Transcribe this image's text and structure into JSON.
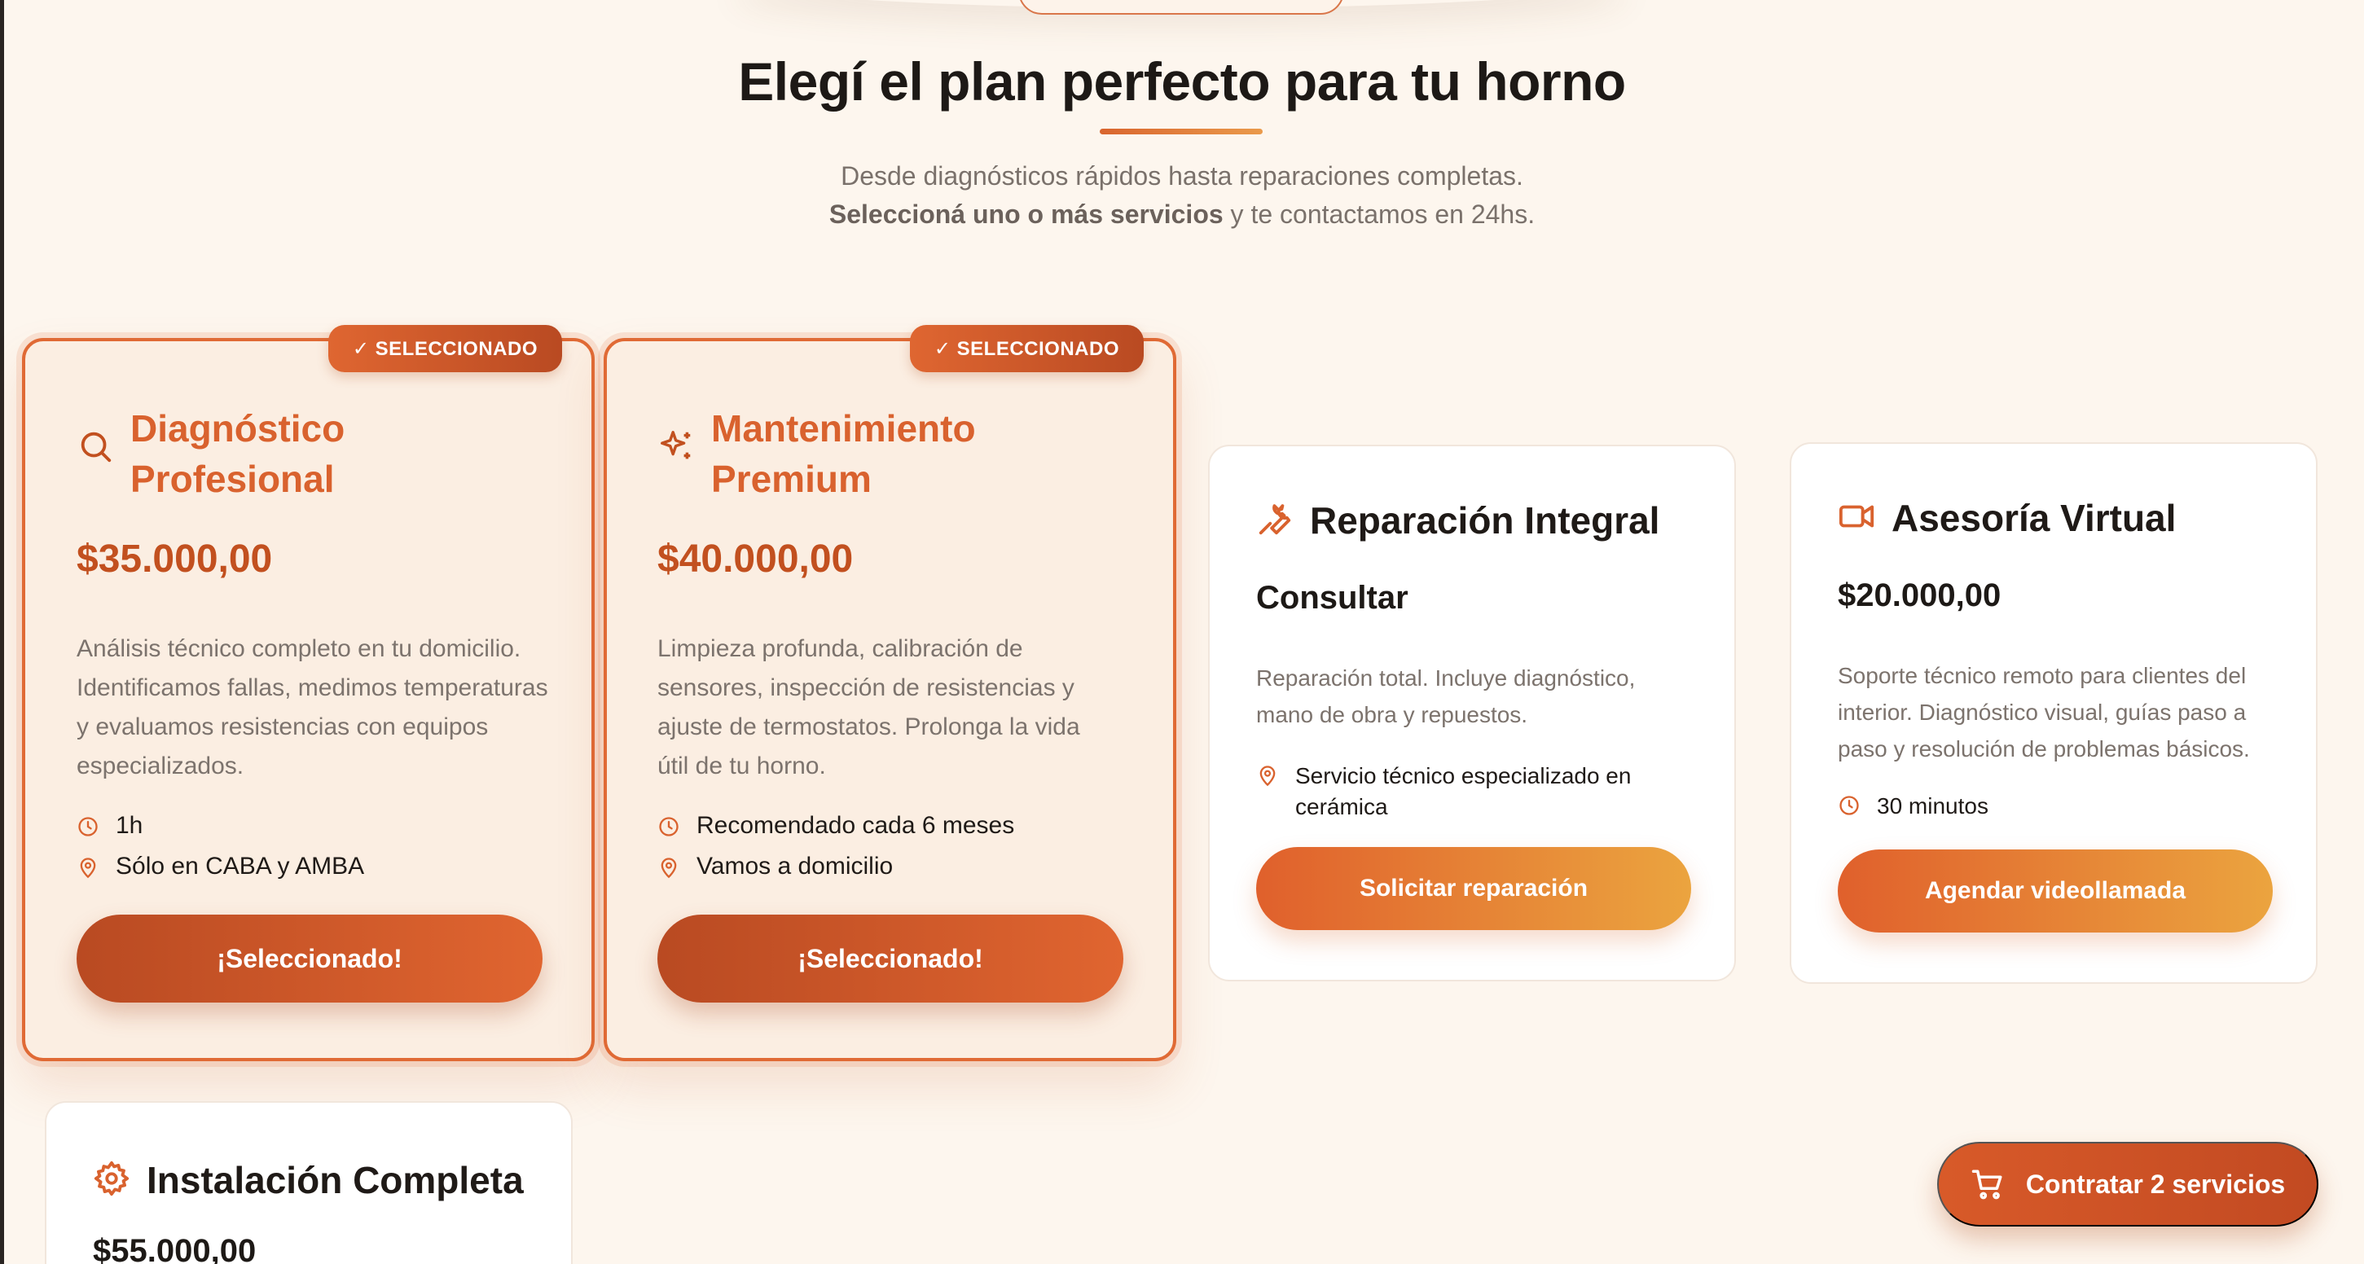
{
  "hero": {
    "title": "Elegí el plan perfecto para tu horno",
    "subtitle_line1": "Desde diagnósticos rápidos hasta reparaciones completas.",
    "subtitle_bold": "Seleccioná uno o más servicios",
    "subtitle_rest": " y te contactamos en 24hs."
  },
  "badge_label": "✓ SELECCIONADO",
  "cards": [
    {
      "title": "Diagnóstico Profesional",
      "icon": "search-icon",
      "price": "$35.000,00",
      "description": "Análisis técnico completo en tu domicilio. Identificamos fallas, medimos temperaturas y evaluamos resistencias con equipos especializados.",
      "meta": [
        {
          "icon": "clock-icon",
          "text": "1h"
        },
        {
          "icon": "map-pin-icon",
          "text": "Sólo en CABA y AMBA"
        }
      ],
      "button": "¡Seleccionado!",
      "selected": true
    },
    {
      "title": "Mantenimiento Premium",
      "icon": "sparkles-icon",
      "price": "$40.000,00",
      "description": "Limpieza profunda, calibración de sensores, inspección de resistencias y ajuste de termostatos. Prolonga la vida útil de tu horno.",
      "meta": [
        {
          "icon": "clock-icon",
          "text": "Recomendado cada 6 meses"
        },
        {
          "icon": "map-pin-icon",
          "text": "Vamos a domicilio"
        }
      ],
      "button": "¡Seleccionado!",
      "selected": true
    },
    {
      "title": "Reparación Integral",
      "icon": "wrench-icon",
      "price": "Consultar",
      "description": "Reparación total. Incluye diagnóstico, mano de obra y repuestos.",
      "meta": [
        {
          "icon": "map-pin-icon",
          "text": "Servicio técnico especializado en cerámica"
        }
      ],
      "button": "Solicitar reparación",
      "selected": false
    },
    {
      "title": "Asesoría Virtual",
      "icon": "video-icon",
      "price": "$20.000,00",
      "description": "Soporte técnico remoto para clientes del interior. Diagnóstico visual, guías paso a paso y resolución de problemas básicos.",
      "meta": [
        {
          "icon": "clock-icon",
          "text": "30 minutos"
        }
      ],
      "button": "Agendar videollamada",
      "selected": false
    },
    {
      "title": "Instalación Completa",
      "icon": "gear-icon",
      "price": "$55.000,00",
      "selected": false
    }
  ],
  "cart": {
    "icon": "cart-icon",
    "label": "Contratar 2 servicios"
  },
  "colors": {
    "accent": "#e06530",
    "accent_dark": "#b94a22",
    "accent_light": "#eba43f",
    "background": "#fdf6ee"
  }
}
